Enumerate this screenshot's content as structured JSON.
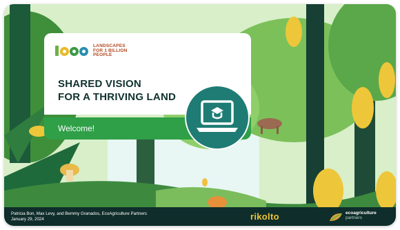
{
  "slide": {
    "logo_lines": [
      "LANDSCAPES",
      "FOR 1 BILLION",
      "PEOPLE"
    ],
    "headline_line1": "SHARED VISION",
    "headline_line2": "FOR A THRIVING LAND",
    "welcome": "Welcome!",
    "credit_line1": "Patricia Bon, Max Levy, and Bemmy Granados, EcoAgriculture Partners",
    "credit_line2": "January 29, 2024",
    "partner1": "rikolto",
    "partner2_line1": "ecoagriculture",
    "partner2_line2": "partners"
  },
  "icons": {
    "course": "laptop-graduation-cap-icon"
  },
  "colors": {
    "brand_green": "#2f9f48",
    "teal_badge": "#1f7c74",
    "footer": "#0f2d2a",
    "headline": "#10322d",
    "rikolto_yellow": "#f2c436"
  }
}
